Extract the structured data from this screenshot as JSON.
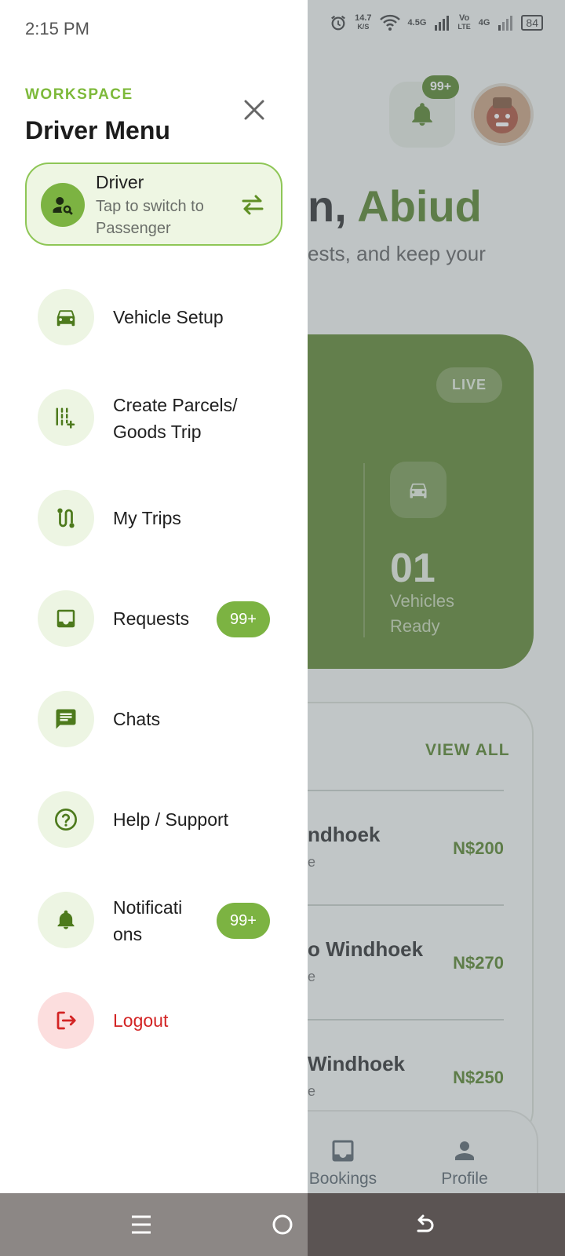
{
  "status_bar": {
    "time": "2:15 PM",
    "net_speed_top": "14.7",
    "net_speed_bottom": "K/S",
    "net_1": "4.5G",
    "volte_top": "Vo",
    "volte_bottom": "LTE",
    "net_2": "4G",
    "battery": "84"
  },
  "background": {
    "bell_badge": "99+",
    "greeting_prefix": "n, ",
    "greeting_name": "Abiud",
    "subtitle": "ests, and keep your",
    "live_badge": "LIVE",
    "vehicles_count": "01",
    "vehicles_label": "Vehicles Ready",
    "view_all": "VIEW ALL",
    "trips": [
      {
        "title": "ndhoek",
        "sub": "e",
        "price": "N$200"
      },
      {
        "title": "o Windhoek",
        "sub": "e",
        "price": "N$270"
      },
      {
        "title": "Windhoek",
        "sub": "e",
        "price": "N$250"
      }
    ],
    "bottom_nav": {
      "bookings": "Bookings",
      "profile": "Profile"
    }
  },
  "drawer": {
    "section": "WORKSPACE",
    "title": "Driver Menu",
    "role": {
      "name": "Driver",
      "hint": "Tap to switch to Passenger"
    },
    "items": [
      {
        "label": "Vehicle Setup",
        "icon": "car-icon"
      },
      {
        "label": "Create Parcels/ Goods Trip",
        "icon": "parcel-add-icon"
      },
      {
        "label": "My Trips",
        "icon": "route-icon"
      },
      {
        "label": "Requests",
        "icon": "inbox-icon",
        "badge": "99+"
      },
      {
        "label": "Chats",
        "icon": "chat-icon"
      },
      {
        "label": "Help / Support",
        "icon": "help-icon"
      },
      {
        "label": "Notificati ons",
        "icon": "bell-icon",
        "badge": "99+"
      },
      {
        "label": "Logout",
        "icon": "logout-icon"
      }
    ]
  },
  "colors": {
    "accent": "#7cb342",
    "accent_dark": "#4d7a1c",
    "card_green": "#557e22",
    "logout_red": "#d32424"
  }
}
